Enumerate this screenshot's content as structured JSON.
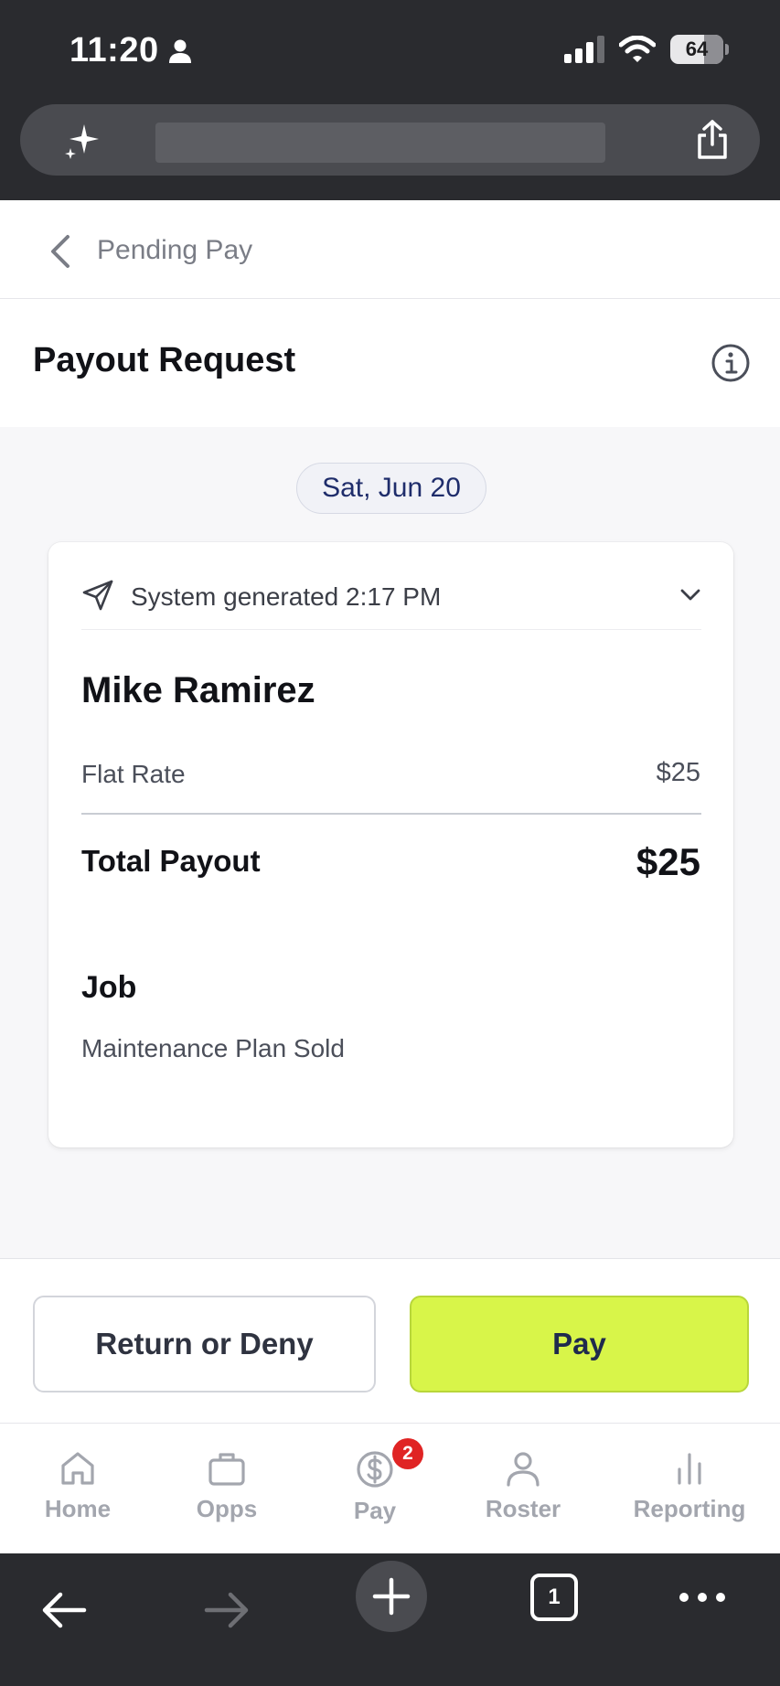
{
  "status_bar": {
    "time": "11:20",
    "battery": "64"
  },
  "navbar": {
    "back_label": "Pending Pay"
  },
  "page": {
    "title": "Payout Request"
  },
  "date_pill": "Sat, Jun 20",
  "card": {
    "system_text": "System generated 2:17 PM",
    "person_name": "Mike Ramirez",
    "rows": [
      {
        "label": "Flat Rate",
        "value": "$25"
      }
    ],
    "total_label": "Total Payout",
    "total_value": "$25",
    "job_label": "Job",
    "job_value": "Maintenance Plan Sold"
  },
  "actions": {
    "deny_label": "Return or Deny",
    "pay_label": "Pay"
  },
  "tabbar": {
    "items": [
      {
        "label": "Home",
        "icon": "home-icon"
      },
      {
        "label": "Opps",
        "icon": "briefcase-icon"
      },
      {
        "label": "Pay",
        "icon": "dollar-circle-icon",
        "badge": "2"
      },
      {
        "label": "Roster",
        "icon": "person-icon"
      },
      {
        "label": "Reporting",
        "icon": "bar-chart-icon"
      }
    ]
  },
  "browser": {
    "tab_count": "1"
  },
  "colors": {
    "accent_green": "#d8f549",
    "badge_red": "#e02424",
    "navy_text": "#1f2d6b"
  }
}
